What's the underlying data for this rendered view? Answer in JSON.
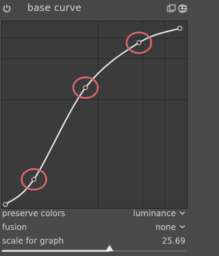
{
  "module": {
    "title": "base curve",
    "icons": [
      "power-icon",
      "presets-icon",
      "reset-icon",
      "menu-icon"
    ]
  },
  "graph": {
    "curve_points": [
      [
        0.0,
        0.0
      ],
      [
        0.16,
        0.14
      ],
      [
        0.45,
        0.65
      ],
      [
        0.75,
        0.9
      ],
      [
        0.98,
        0.98
      ]
    ],
    "highlighted_points": [
      1,
      2,
      3
    ],
    "highlight_color": "#e06a6a",
    "curve_color": "#eeeeee",
    "grid_color": "#2a2a2a"
  },
  "params": {
    "preserve_colors": {
      "label": "preserve colors",
      "value": "luminance"
    },
    "fusion": {
      "label": "fusion",
      "value": "none"
    },
    "scale": {
      "label": "scale for graph",
      "value": "25.69",
      "fraction": 0.58
    }
  },
  "colors": {
    "panel": "#4a4a4a",
    "graph_bg": "#3b3b3b",
    "text": "#d4d4d4"
  }
}
